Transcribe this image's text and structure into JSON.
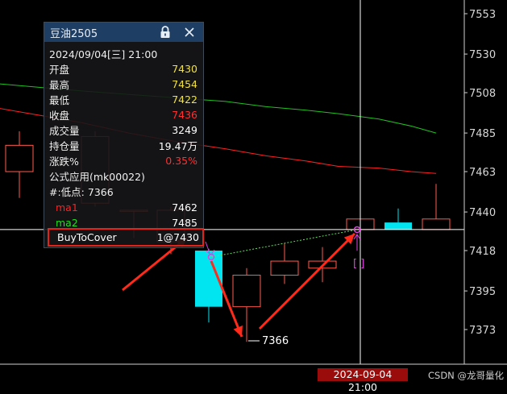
{
  "panel": {
    "title": "豆油2505",
    "date": "2024/09/04[三] 21:00",
    "rows": [
      {
        "label": "开盘",
        "value": "7430",
        "color": "#f0e040"
      },
      {
        "label": "最高",
        "value": "7454",
        "color": "#f0e040"
      },
      {
        "label": "最低",
        "value": "7422",
        "color": "#f0e040"
      },
      {
        "label": "收盘",
        "value": "7436",
        "color": "#ff3030"
      },
      {
        "label": "成交量",
        "value": "3249",
        "color": "#ffffff"
      },
      {
        "label": "持仓量",
        "value": "19.47万",
        "color": "#ffffff"
      },
      {
        "label": "涨跌%",
        "value": "0.35%",
        "color": "#ff3030"
      }
    ],
    "formula": "公式应用(mk00022)",
    "lowpoint": "#:低点: 7366",
    "ma": [
      {
        "label": "ma1",
        "value": "7462",
        "color": "#ff2020"
      },
      {
        "label": "ma2",
        "value": "7485",
        "color": "#20e020"
      }
    ],
    "signal": {
      "label": "BuyToCover",
      "value": "1@7430"
    },
    "icons": [
      "lock-icon",
      "close-icon"
    ]
  },
  "chart_data": {
    "type": "candlestick",
    "y_ticks": [
      "7553",
      "7530",
      "7508",
      "7485",
      "7463",
      "7440",
      "7418",
      "7395",
      "7373"
    ],
    "ylim": [
      7350,
      7560
    ],
    "crosshair_price": 7430,
    "candles": [
      {
        "o": 7463,
        "c": 7478,
        "h": 7486,
        "l": 7448
      },
      {
        "o": 7445,
        "c": 7483,
        "h": 7486,
        "l": 7443
      },
      {
        "o": 7441,
        "c": 7441,
        "h": 7441,
        "l": 7425
      },
      {
        "o": 7423,
        "c": 7441,
        "h": 7444,
        "l": 7418
      },
      {
        "o": 7423,
        "c": 7441,
        "h": 7443,
        "l": 7416
      },
      {
        "o": 7418,
        "c": 7386,
        "h": 7419,
        "l": 7377
      },
      {
        "o": 7386,
        "c": 7404,
        "h": 7408,
        "l": 7366
      },
      {
        "o": 7404,
        "c": 7412,
        "h": 7422,
        "l": 7399
      },
      {
        "o": 7408,
        "c": 7412,
        "h": 7420,
        "l": 7400
      },
      {
        "o": 7430,
        "c": 7436,
        "h": 7436,
        "l": 7430
      },
      {
        "o": 7434,
        "c": 7430,
        "h": 7442,
        "l": 7430
      },
      {
        "o": 7430,
        "c": 7436,
        "h": 7456,
        "l": 7430
      }
    ],
    "ma1_series": [
      7499,
      7495,
      7491,
      7485,
      7480,
      7476,
      7472,
      7469,
      7466,
      7465,
      7463,
      7462
    ],
    "ma2_series": [
      7513,
      7511,
      7509,
      7507,
      7505,
      7503,
      7500,
      7498,
      7496,
      7493,
      7489,
      7485
    ],
    "low_label": "7366",
    "signal_marker": "[ ]",
    "colors": {
      "up": "#ff5a4e",
      "down": "#00e5f0",
      "ma1": "#ff2020",
      "ma2": "#20c020",
      "marker": "#e040e0"
    }
  },
  "bottombar": {
    "datetime": "2024-09-04 21:00",
    "watermark": "CSDN @龙哥量化"
  }
}
